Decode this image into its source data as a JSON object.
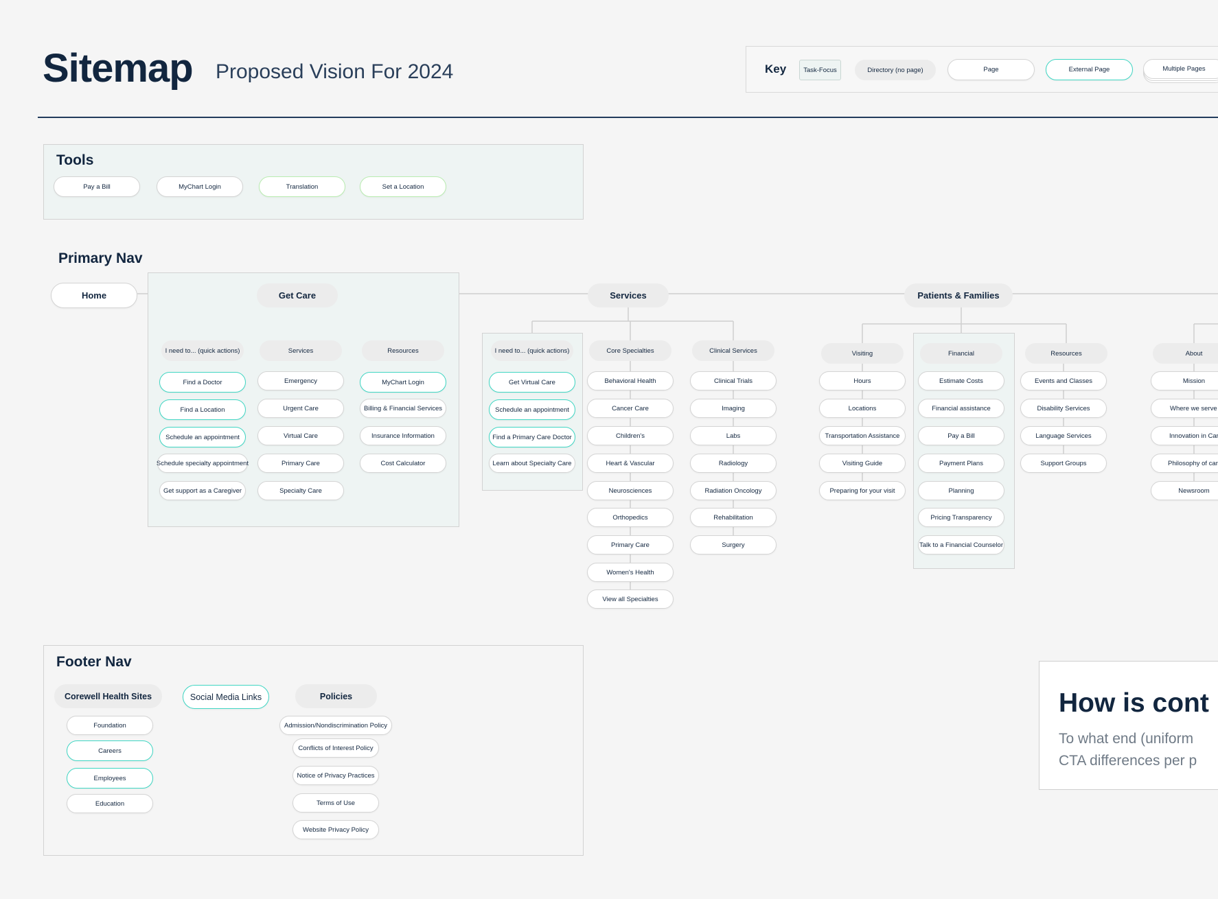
{
  "header": {
    "title": "Sitemap",
    "subtitle": "Proposed Vision For 2024"
  },
  "key": {
    "label": "Key",
    "items": [
      "Task-Focus",
      "Directory (no page)",
      "Page",
      "External Page",
      "Multiple Pages"
    ]
  },
  "colors": {
    "navy": "#12263f",
    "external_outline": "#3fd6c3",
    "section_tint": "#eef4f3",
    "directory_fill": "#ececec"
  },
  "tools": {
    "heading": "Tools",
    "items": [
      "Pay a Bill",
      "MyChart Login",
      "Translation",
      "Set a Location"
    ]
  },
  "primary_nav": {
    "heading": "Primary Nav",
    "home": "Home",
    "get_care": {
      "label": "Get Care",
      "quick": {
        "label": "I need to...  (quick actions)",
        "items": [
          "Find a Doctor",
          "Find a Location",
          "Schedule an appointment",
          "Schedule specialty appointment",
          "Get support as a Caregiver"
        ]
      },
      "services": {
        "label": "Services",
        "items": [
          "Emergency",
          "Urgent Care",
          "Virtual Care",
          "Primary Care",
          "Specialty Care"
        ]
      },
      "resources": {
        "label": "Resources",
        "items": [
          "MyChart Login",
          "Billing & Financial Services",
          "Insurance Information",
          "Cost Calculator"
        ]
      }
    },
    "services": {
      "label": "Services",
      "quick": {
        "label": "I need to...  (quick actions)",
        "items": [
          "Get Virtual Care",
          "Schedule an appointment",
          "Find a Primary Care Doctor",
          "Learn about Specialty Care"
        ]
      },
      "core": {
        "label": "Core Specialties",
        "items": [
          "Behavioral Health",
          "Cancer Care",
          "Children's",
          "Heart & Vascular",
          "Neurosciences",
          "Orthopedics",
          "Primary Care",
          "Women's Health",
          "View all Specialties"
        ]
      },
      "clinical": {
        "label": "Clinical Services",
        "items": [
          "Clinical Trials",
          "Imaging",
          "Labs",
          "Radiology",
          "Radiation Oncology",
          "Rehabilitation",
          "Surgery"
        ]
      }
    },
    "patients": {
      "label": "Patients & Families",
      "visiting": {
        "label": "Visiting",
        "items": [
          "Hours",
          "Locations",
          "Transportation Assistance",
          "Visiting Guide",
          "Preparing for your visit"
        ]
      },
      "financial": {
        "label": "Financial",
        "items": [
          "Estimate Costs",
          "Financial assistance",
          "Pay a Bill",
          "Payment Plans",
          "Planning",
          "Pricing Transparency",
          "Talk to a Financial Counselor"
        ]
      },
      "resources": {
        "label": "Resources",
        "items": [
          "Events and Classes",
          "Disability Services",
          "Language Services",
          "Support Groups"
        ]
      }
    },
    "about": {
      "label": "About",
      "items": [
        "Mission",
        "Where we serve",
        "Innovation in Care",
        "Philosophy of care",
        "Newsroom"
      ]
    }
  },
  "footer_nav": {
    "heading": "Footer Nav",
    "sites": {
      "label": "Corewell Health Sites",
      "items": [
        "Foundation",
        "Careers",
        "Employees",
        "Education"
      ]
    },
    "social": {
      "label": "Social Media Links"
    },
    "policies": {
      "label": "Policies",
      "items": [
        "Admission/Nondiscrimination Policy",
        "Conflicts of Interest Policy",
        "Notice of Privacy Practices",
        "Terms of Use",
        "Website Privacy Policy"
      ]
    }
  },
  "callout": {
    "heading": "How is cont",
    "line1": "To what end (uniform",
    "line2": "CTA differences per p"
  }
}
